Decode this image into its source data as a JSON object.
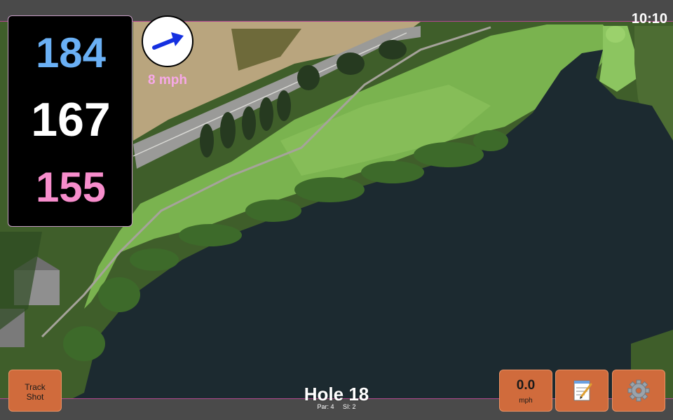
{
  "status_bar": {
    "time": "10:10"
  },
  "yardages": {
    "back": "184",
    "middle": "167",
    "front": "155"
  },
  "wind": {
    "speed_label": "8 mph",
    "direction_icon": "arrow-icon"
  },
  "hole": {
    "title": "Hole 18",
    "par_label": "Par: 4",
    "si_label": "SI: 2"
  },
  "buttons": {
    "track_shot_line1": "Track",
    "track_shot_line2": "Shot",
    "speed_value": "0.0",
    "speed_unit": "mph",
    "notes_icon": "notepad-icon",
    "settings_icon": "gear-icon"
  },
  "colors": {
    "back_yardage": "#6ab0f5",
    "middle_yardage": "#ffffff",
    "front_yardage": "#f78dcc",
    "wind_speed": "#f7a8e8",
    "button_orange": "#d06b3c",
    "water": "#1c2a30",
    "fairway": "#6ea94a"
  }
}
